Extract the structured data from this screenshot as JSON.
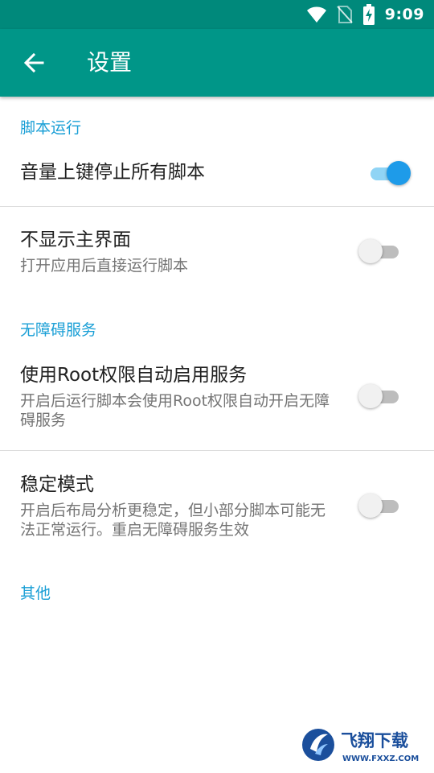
{
  "status_bar": {
    "time": "9:09",
    "icons": [
      "wifi-icon",
      "no-sim-icon",
      "battery-charging-icon"
    ]
  },
  "app_bar": {
    "title": "设置",
    "back_icon": "arrow-left-icon"
  },
  "sections": [
    {
      "title": "脚本运行",
      "items": [
        {
          "title": "音量上键停止所有脚本",
          "summary": "",
          "enabled": true
        }
      ]
    },
    {
      "title": "",
      "items": [
        {
          "title": "不显示主界面",
          "summary": "打开应用后直接运行脚本",
          "enabled": false
        }
      ]
    },
    {
      "title": "无障碍服务",
      "items": [
        {
          "title": "使用Root权限自动启用服务",
          "summary": "开启后运行脚本会使用Root权限自动开启无障碍服务",
          "enabled": false
        }
      ]
    },
    {
      "title": "",
      "items": [
        {
          "title": "稳定模式",
          "summary": "开启后布局分析更稳定，但小部分脚本可能无法正常运行。重启无障碍服务生效",
          "enabled": false
        }
      ]
    },
    {
      "title": "其他",
      "items": []
    }
  ],
  "watermark": {
    "brand": "飞翔下载",
    "url": "WWW.FXXZ.COM"
  },
  "colors": {
    "status_bar": "#00897b",
    "app_bar": "#009688",
    "accent": "#1a9fd6",
    "switch_on_thumb": "#1e9be9",
    "switch_on_track": "#90d4f5"
  }
}
